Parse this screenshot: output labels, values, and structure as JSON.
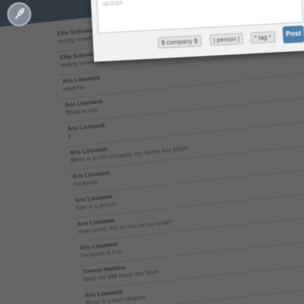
{
  "header": {
    "logo_icon": "rocket-logo-icon"
  },
  "composer": {
    "placeholder": "update",
    "company_button": "$ company $",
    "person_button": "| person |",
    "tag_button": "* tag *",
    "post_button": "Post"
  },
  "feed": {
    "items": [
      {
        "author": "Ellie Schroeder",
        "message": "testing something"
      },
      {
        "author": "Ellie Schroeder",
        "message": "testing something"
      },
      {
        "author": "Aris Lissowsk",
        "message": "whatcha"
      },
      {
        "author": "Aris Lissowsk",
        "message": "$fixes is cool"
      },
      {
        "author": "Aris Lissowsk",
        "message": "it"
      },
      {
        "author": "Aris Lissowsk",
        "message": "$fixes is a cool company. my names Aris $5000"
      },
      {
        "author": "Aris Lissowsk",
        "message": "Facebook"
      },
      {
        "author": "Aris Lissowsk",
        "message": "Sam is a person"
      },
      {
        "author": "Aris Lissowsk",
        "message": "Hello world, this as may be too small?"
      },
      {
        "author": "Aris Lissowsk",
        "message": "Facebook & Fun"
      },
      {
        "author": "Tommy Hopkins",
        "message": "Make me $$$ lonely this Mash"
      },
      {
        "author": "Aris Lissowsk",
        "message": "$fixes is a cool company"
      }
    ]
  }
}
